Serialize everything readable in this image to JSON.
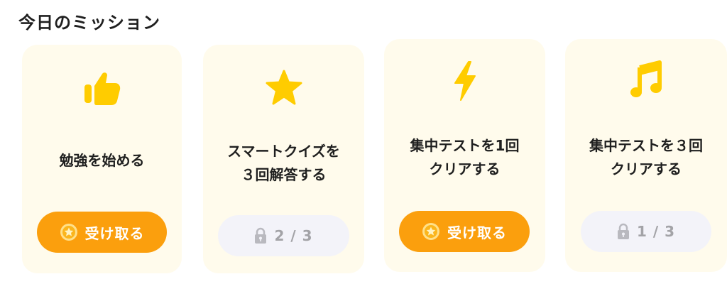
{
  "header": {
    "title": "今日のミッション"
  },
  "missions": [
    {
      "icon": "thumbs-up-icon",
      "text": "勉強を始める",
      "action": {
        "state": "claim",
        "label": "受け取る"
      }
    },
    {
      "icon": "star-icon",
      "text": "スマートクイズを\n３回解答する",
      "action": {
        "state": "locked",
        "label": "2 / 3"
      }
    },
    {
      "icon": "lightning-icon",
      "text": "集中テストを1回\nクリアする",
      "action": {
        "state": "claim",
        "label": "受け取る"
      }
    },
    {
      "icon": "music-note-icon",
      "text": "集中テストを３回\nクリアする",
      "action": {
        "state": "locked",
        "label": "1 / 3"
      }
    }
  ],
  "colors": {
    "card_bg": "#fffbec",
    "accent": "#fb9f0d",
    "icon_yellow": "#ffcc00",
    "locked_bg": "#f3f3f9",
    "locked_text": "#a3a3a7"
  }
}
